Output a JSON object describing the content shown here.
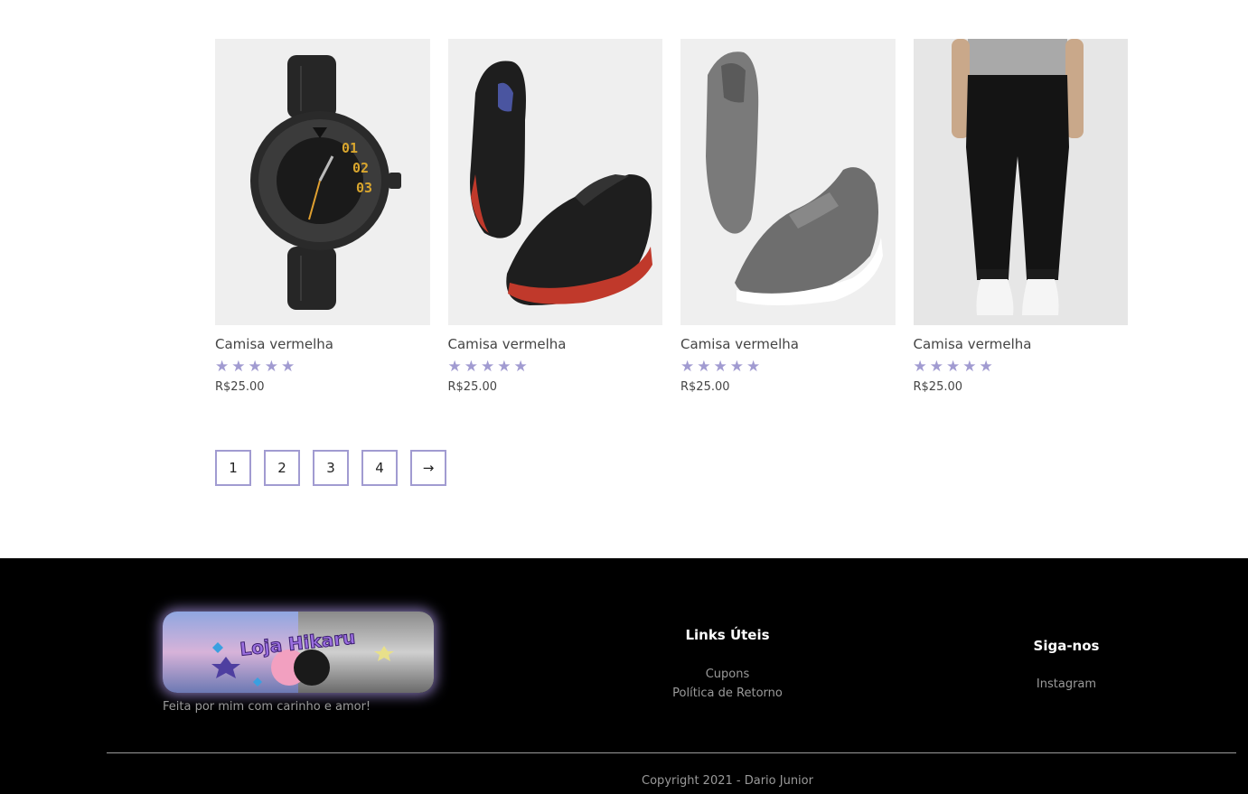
{
  "products": [
    {
      "title": "Camisa vermelha",
      "price": "R$25.00",
      "rating": 5,
      "image": "watch-image"
    },
    {
      "title": "Camisa vermelha",
      "price": "R$25.00",
      "rating": 5,
      "image": "black-sneakers-image"
    },
    {
      "title": "Camisa vermelha",
      "price": "R$25.00",
      "rating": 5,
      "image": "grey-slip-on-image"
    },
    {
      "title": "Camisa vermelha",
      "price": "R$25.00",
      "rating": 5,
      "image": "joggers-image"
    }
  ],
  "star_glyph": "★",
  "pagination": {
    "pages": [
      "1",
      "2",
      "3",
      "4"
    ],
    "next": "→"
  },
  "footer": {
    "logo_text": "Loja Hikaru",
    "tagline": "Feita por mim com carinho e amor!",
    "useful_links": {
      "title": "Links Úteis",
      "links": [
        "Cupons",
        "Política de Retorno"
      ]
    },
    "follow": {
      "title": "Siga-nos",
      "links": [
        "Instagram"
      ]
    },
    "copyright": "Copyright 2021 - Dario Junior"
  },
  "colors": {
    "accent": "#a19bd1",
    "footer_bg": "#000000",
    "muted_text": "#9a9a9a"
  }
}
